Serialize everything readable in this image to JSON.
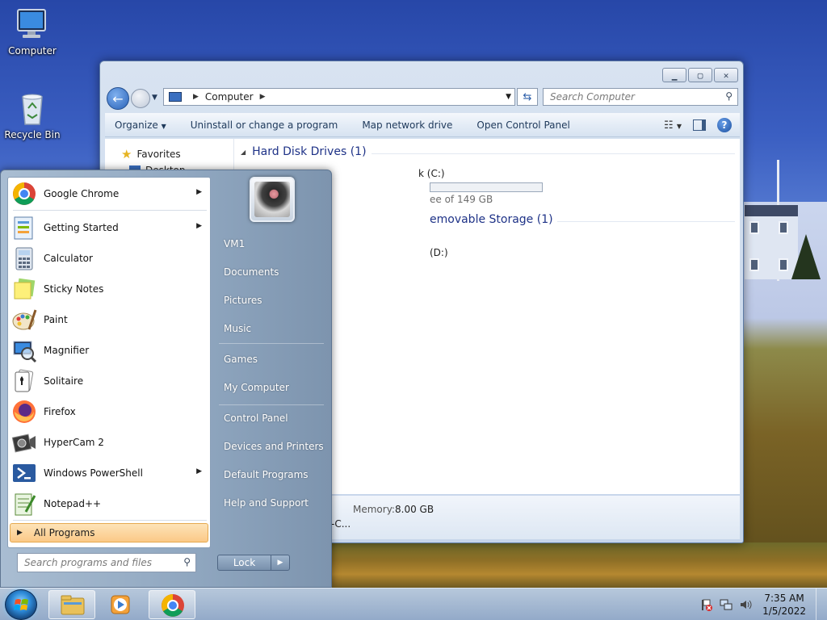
{
  "desktop": {
    "icons": [
      {
        "label": "Computer",
        "icon": "computer-icon"
      },
      {
        "label": "Recycle Bin",
        "icon": "recycle-bin-icon"
      }
    ]
  },
  "explorer": {
    "address": {
      "root": "Computer"
    },
    "search_placeholder": "Search Computer",
    "commands": [
      "Organize",
      "Uninstall or change a program",
      "Map network drive",
      "Open Control Panel"
    ],
    "nav": {
      "favorites": "Favorites",
      "desktop": "Desktop"
    },
    "groups": {
      "hdd_title": "Hard Disk Drives (1)",
      "hdd_drive_label": "k (C:)",
      "hdd_drive_free": "ee of 149 GB",
      "hdd_used_fraction": 0.0,
      "removable_title": "emovable Storage (1)",
      "removable_drive_label": "(D:)"
    },
    "details": {
      "memory_label": "Memory:",
      "memory_value": "8.00 GB",
      "cpu_tail": "-C..."
    }
  },
  "start_menu": {
    "programs": [
      {
        "label": "Google Chrome",
        "icon": "chrome-icon",
        "submenu": true
      },
      {
        "label": "Getting Started",
        "icon": "getting-started-icon",
        "submenu": true
      },
      {
        "label": "Calculator",
        "icon": "calculator-icon",
        "submenu": false
      },
      {
        "label": "Sticky Notes",
        "icon": "sticky-notes-icon",
        "submenu": false
      },
      {
        "label": "Paint",
        "icon": "paint-icon",
        "submenu": false
      },
      {
        "label": "Magnifier",
        "icon": "magnifier-icon",
        "submenu": false
      },
      {
        "label": "Solitaire",
        "icon": "solitaire-icon",
        "submenu": false
      },
      {
        "label": "Firefox",
        "icon": "firefox-icon",
        "submenu": false
      },
      {
        "label": "HyperCam 2",
        "icon": "hypercam-icon",
        "submenu": false
      },
      {
        "label": "Windows PowerShell",
        "icon": "powershell-icon",
        "submenu": true
      },
      {
        "label": "Notepad++",
        "icon": "notepadpp-icon",
        "submenu": false
      }
    ],
    "all_programs": "All Programs",
    "search_placeholder": "Search programs and files",
    "right_links": [
      "VM1",
      "Documents",
      "Pictures",
      "Music",
      "Games",
      "My Computer",
      "Control Panel",
      "Devices and Printers",
      "Default Programs",
      "Help and Support"
    ],
    "lock_label": "Lock"
  },
  "taskbar": {
    "clock_time": "7:35 AM",
    "clock_date": "1/5/2022"
  },
  "colors": {
    "group_title": "#1e3287",
    "all_programs_bg": "#fbc987",
    "taskbar": "#a9c0e0"
  }
}
